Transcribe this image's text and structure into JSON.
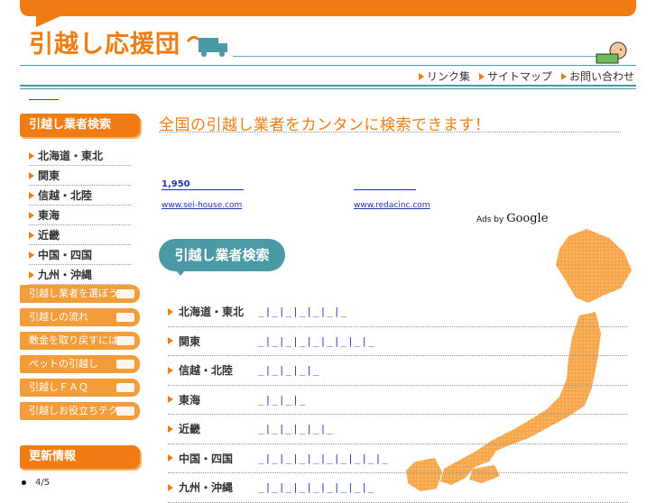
{
  "header": {
    "logo_text": "引越し応援団",
    "nav": [
      {
        "label": "リンク集"
      },
      {
        "label": "サイトマップ"
      },
      {
        "label": "お問い合わせ"
      }
    ]
  },
  "sidebar": {
    "search_heading": "引越し業者検索",
    "regions": [
      "北海道・東北",
      "関東",
      "信越・北陸",
      "東海",
      "近畿",
      "中国・四国",
      "九州・沖縄"
    ],
    "buttons": [
      "引越し業者を選ぼう",
      "引越しの流れ",
      "敷金を取り戻すには",
      "ペットの引越し",
      "引越しＦＡＱ",
      "引越しお役立ちテク"
    ],
    "news_heading": "更新情報",
    "news_item": "4/5"
  },
  "main": {
    "headline": "全国の引越し業者をカンタンに検索できます！",
    "ads": {
      "count": "1,950",
      "url1": "www.sei-house.com",
      "url2": "www.redacinc.com",
      "ads_by": "Ads by",
      "google": "Google"
    },
    "search_label": "引越し業者検索",
    "region_rows": [
      {
        "name": "北海道・東北",
        "links": "_|_|_|_|_|_|_"
      },
      {
        "name": "関東",
        "links": "_|_|_|_|_|_|_|_|_"
      },
      {
        "name": "信越・北陸",
        "links": "_|_|_|_|_"
      },
      {
        "name": "東海",
        "links": "_|_|_|_"
      },
      {
        "name": "近畿",
        "links": "_|_|_|_|_|_"
      },
      {
        "name": "中国・四国",
        "links": "_|_|_|_|_|_|_|_|_|_"
      },
      {
        "name": "九州・沖縄",
        "links": "_|_|_|_|_|_|_|_|_"
      }
    ]
  },
  "colors": {
    "accent": "#f07c13",
    "teal": "#4a9aa6",
    "link": "#2233bb"
  }
}
